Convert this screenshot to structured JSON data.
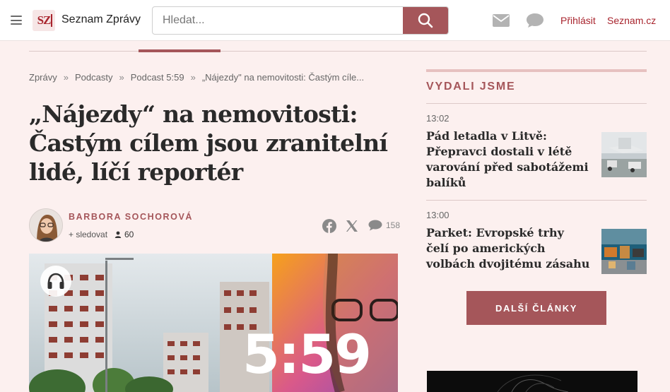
{
  "header": {
    "menu_icon": "hamburger-icon",
    "logo_mark": "SZ",
    "logo_text": "Seznam Zprávy",
    "search_placeholder": "Hledat...",
    "search_icon": "search-icon",
    "mail_icon": "mail-icon",
    "chat_icon": "chat-icon",
    "login_label": "Přihlásit",
    "seznam_label": "Seznam.cz"
  },
  "breadcrumb": {
    "items": [
      "Zprávy",
      "Podcasty",
      "Podcast 5:59",
      "„Nájezdy\" na nemovitosti: Častým cíle..."
    ],
    "separator": "»"
  },
  "article": {
    "headline_lines": [
      "„Nájezdy“ na nemovitosti:",
      "Častým cílem jsou zranitelní",
      "lidé, líčí reportér"
    ],
    "author_name": "BARBORA SOCHOROVÁ",
    "follow_label": "+ sledovat",
    "followers_count": "60",
    "comments_count": "158",
    "hero_brand_text": "5:59",
    "share_icons": [
      "facebook-icon",
      "x-icon",
      "comment-icon"
    ]
  },
  "sidebar": {
    "title": "VYDALI JSME",
    "items": [
      {
        "time": "13:02",
        "headline": "Pád letadla v Litvě: Přepravci dostali v létě varování před sabotážemi balíků"
      },
      {
        "time": "13:00",
        "headline": "Parket: Evropské trhy čelí po amerických volbách dvojitému zásahu"
      }
    ],
    "more_label": "DALŠÍ ČLÁNKY"
  },
  "colors": {
    "accent": "#a5565a",
    "brand_red": "#a8242d",
    "background": "#fcf0ef"
  }
}
